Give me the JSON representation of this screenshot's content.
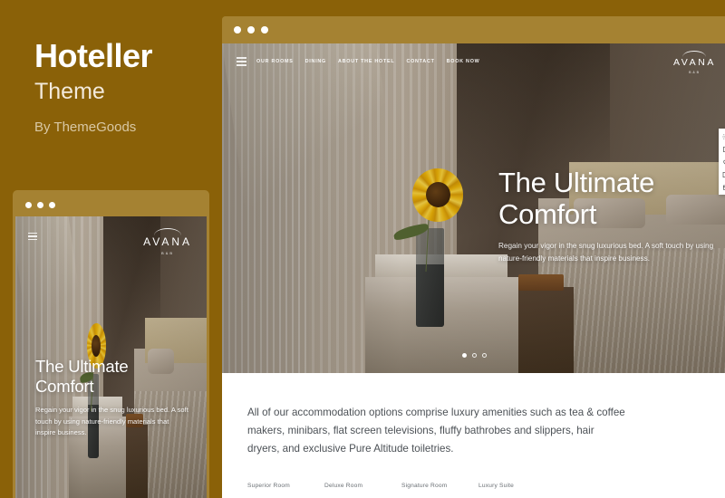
{
  "promo": {
    "title": "Hoteller",
    "subtitle": "Theme",
    "byline": "By ThemeGoods"
  },
  "colors": {
    "page_background": "#8a6108",
    "browser_chrome": "#a58232",
    "accent_white": "#ffffff",
    "body_text": "#4c5156"
  },
  "desktop_window": {
    "traffic_lights": [
      "dot-1",
      "dot-2",
      "dot-3"
    ],
    "nav": {
      "menu_icon": "hamburger-icon",
      "links": [
        "OUR ROOMS",
        "DINING",
        "ABOUT THE HOTEL",
        "CONTACT",
        "BOOK NOW"
      ]
    },
    "brand": {
      "name": "AVANA",
      "tagline": "B&B"
    },
    "hero": {
      "heading_line1": "The Ultimate",
      "heading_line2": "Comfort",
      "paragraph": "Regain your vigor in the snug luxurious bed. A soft touch by using nature-friendly materials that inspire business."
    },
    "slider": {
      "dots": 3,
      "active_index": 0
    },
    "side_toolbar": [
      "gear-icon",
      "square-icon",
      "heart-icon",
      "columns-icon",
      "cart-icon"
    ],
    "content": {
      "paragraph": "All of our accommodation options comprise luxury amenities such as tea & coffee makers, minibars, flat screen televisions, fluffy bathrobes and slippers, hair dryers, and exclusive Pure Altitude toiletries.",
      "rooms": [
        "Superior Room",
        "Deluxe Room",
        "Signature Room",
        "Luxury Suite"
      ]
    }
  },
  "mobile_window": {
    "traffic_lights": [
      "dot-1",
      "dot-2",
      "dot-3"
    ],
    "menu_icon": "hamburger-icon",
    "brand": {
      "name": "AVANA",
      "tagline": "B&B"
    },
    "hero": {
      "heading_line1": "The Ultimate",
      "heading_line2": "Comfort",
      "paragraph": "Regain your vigor in the snug luxurious bed. A soft touch by using nature-friendly materials that inspire business."
    }
  }
}
